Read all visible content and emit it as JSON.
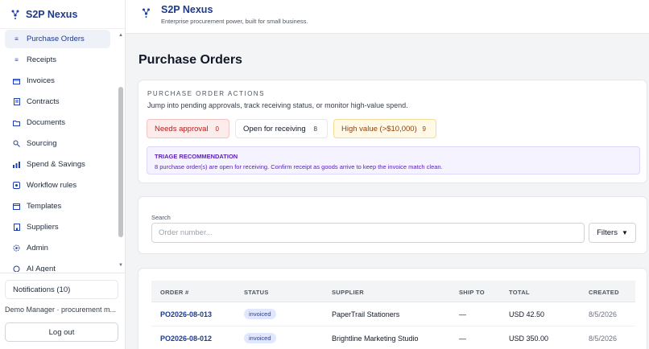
{
  "brand": {
    "name": "S2P Nexus",
    "tagline": "Enterprise procurement power, built for small business."
  },
  "sidebar": {
    "items": [
      {
        "label": "Purchase Orders",
        "icon": "list-icon",
        "active": true
      },
      {
        "label": "Receipts",
        "icon": "receipt-icon"
      },
      {
        "label": "Invoices",
        "icon": "invoice-icon"
      },
      {
        "label": "Contracts",
        "icon": "contract-icon"
      },
      {
        "label": "Documents",
        "icon": "folder-icon"
      },
      {
        "label": "Sourcing",
        "icon": "sourcing-icon"
      },
      {
        "label": "Spend & Savings",
        "icon": "bar-chart-icon"
      },
      {
        "label": "Workflow rules",
        "icon": "workflow-icon"
      },
      {
        "label": "Templates",
        "icon": "template-icon"
      },
      {
        "label": "Suppliers",
        "icon": "supplier-icon"
      },
      {
        "label": "Admin",
        "icon": "gear-icon"
      },
      {
        "label": "AI Agent",
        "icon": "ai-agent-icon"
      }
    ],
    "notifications_label": "Notifications (10)",
    "user_line": "Demo Manager · procurement m...",
    "logout_label": "Log out"
  },
  "page": {
    "title": "Purchase Orders"
  },
  "actions": {
    "heading": "PURCHASE ORDER ACTIONS",
    "description": "Jump into pending approvals, track receiving status, or monitor high-value spend.",
    "pills": [
      {
        "label": "Needs approval",
        "count": "0"
      },
      {
        "label": "Open for receiving",
        "count": "8"
      },
      {
        "label": "High value (>$10,000)",
        "count": "9"
      }
    ],
    "triage": {
      "title": "TRIAGE RECOMMENDATION",
      "text": "8 purchase order(s) are open for receiving. Confirm receipt as goods arrive to keep the invoice match clean."
    }
  },
  "search": {
    "label": "Search",
    "placeholder": "Order number...",
    "filters_label": "Filters"
  },
  "table": {
    "headers": [
      "ORDER #",
      "STATUS",
      "SUPPLIER",
      "SHIP TO",
      "TOTAL",
      "CREATED"
    ],
    "rows": [
      {
        "order": "PO2026-08-013",
        "status": "invoiced",
        "supplier": "PaperTrail Stationers",
        "ship_to": "—",
        "total": "USD 42.50",
        "created": "8/5/2026"
      },
      {
        "order": "PO2026-08-012",
        "status": "invoiced",
        "supplier": "Brightline Marketing Studio",
        "ship_to": "—",
        "total": "USD 350.00",
        "created": "8/5/2026"
      }
    ]
  },
  "colors": {
    "brand": "#1e3a8a",
    "danger": "#b91c1c",
    "warning": "#92400e",
    "triage": "#5b21b6"
  }
}
